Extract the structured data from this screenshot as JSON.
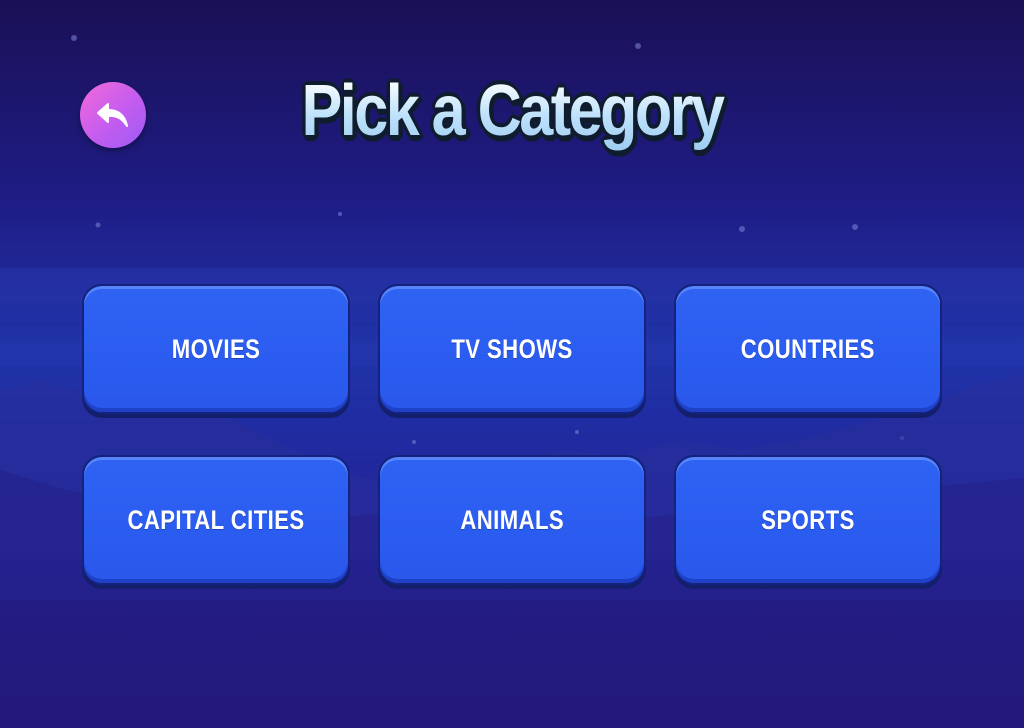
{
  "header": {
    "title": "Pick a Category",
    "back_icon": "reply-arrow-icon"
  },
  "categories": [
    {
      "label": "MOVIES"
    },
    {
      "label": "TV SHOWS"
    },
    {
      "label": "COUNTRIES"
    },
    {
      "label": "CAPITAL CITIES"
    },
    {
      "label": "ANIMALS"
    },
    {
      "label": "SPORTS"
    }
  ],
  "colors": {
    "background_top": "#1a1056",
    "background_mid": "#1f33a8",
    "button_fill": "#2f63f3",
    "button_border": "#13227a",
    "back_button_start": "#f36ad8",
    "back_button_end": "#9a5cf5",
    "title_fill": "#d9f0ff",
    "title_outline": "#0f1c2e"
  }
}
